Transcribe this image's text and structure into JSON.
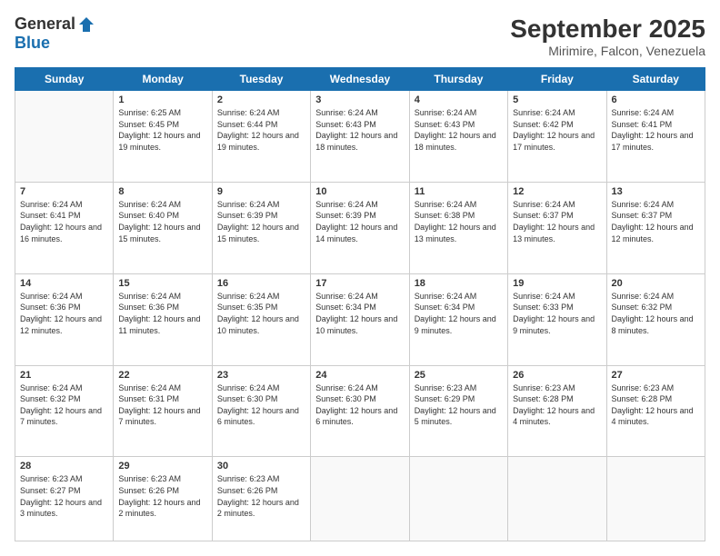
{
  "logo": {
    "general": "General",
    "blue": "Blue"
  },
  "title": "September 2025",
  "subtitle": "Mirimire, Falcon, Venezuela",
  "days": [
    "Sunday",
    "Monday",
    "Tuesday",
    "Wednesday",
    "Thursday",
    "Friday",
    "Saturday"
  ],
  "weeks": [
    [
      {
        "num": "",
        "sunrise": "",
        "sunset": "",
        "daylight": ""
      },
      {
        "num": "1",
        "sunrise": "Sunrise: 6:25 AM",
        "sunset": "Sunset: 6:45 PM",
        "daylight": "Daylight: 12 hours and 19 minutes."
      },
      {
        "num": "2",
        "sunrise": "Sunrise: 6:24 AM",
        "sunset": "Sunset: 6:44 PM",
        "daylight": "Daylight: 12 hours and 19 minutes."
      },
      {
        "num": "3",
        "sunrise": "Sunrise: 6:24 AM",
        "sunset": "Sunset: 6:43 PM",
        "daylight": "Daylight: 12 hours and 18 minutes."
      },
      {
        "num": "4",
        "sunrise": "Sunrise: 6:24 AM",
        "sunset": "Sunset: 6:43 PM",
        "daylight": "Daylight: 12 hours and 18 minutes."
      },
      {
        "num": "5",
        "sunrise": "Sunrise: 6:24 AM",
        "sunset": "Sunset: 6:42 PM",
        "daylight": "Daylight: 12 hours and 17 minutes."
      },
      {
        "num": "6",
        "sunrise": "Sunrise: 6:24 AM",
        "sunset": "Sunset: 6:41 PM",
        "daylight": "Daylight: 12 hours and 17 minutes."
      }
    ],
    [
      {
        "num": "7",
        "sunrise": "Sunrise: 6:24 AM",
        "sunset": "Sunset: 6:41 PM",
        "daylight": "Daylight: 12 hours and 16 minutes."
      },
      {
        "num": "8",
        "sunrise": "Sunrise: 6:24 AM",
        "sunset": "Sunset: 6:40 PM",
        "daylight": "Daylight: 12 hours and 15 minutes."
      },
      {
        "num": "9",
        "sunrise": "Sunrise: 6:24 AM",
        "sunset": "Sunset: 6:39 PM",
        "daylight": "Daylight: 12 hours and 15 minutes."
      },
      {
        "num": "10",
        "sunrise": "Sunrise: 6:24 AM",
        "sunset": "Sunset: 6:39 PM",
        "daylight": "Daylight: 12 hours and 14 minutes."
      },
      {
        "num": "11",
        "sunrise": "Sunrise: 6:24 AM",
        "sunset": "Sunset: 6:38 PM",
        "daylight": "Daylight: 12 hours and 13 minutes."
      },
      {
        "num": "12",
        "sunrise": "Sunrise: 6:24 AM",
        "sunset": "Sunset: 6:37 PM",
        "daylight": "Daylight: 12 hours and 13 minutes."
      },
      {
        "num": "13",
        "sunrise": "Sunrise: 6:24 AM",
        "sunset": "Sunset: 6:37 PM",
        "daylight": "Daylight: 12 hours and 12 minutes."
      }
    ],
    [
      {
        "num": "14",
        "sunrise": "Sunrise: 6:24 AM",
        "sunset": "Sunset: 6:36 PM",
        "daylight": "Daylight: 12 hours and 12 minutes."
      },
      {
        "num": "15",
        "sunrise": "Sunrise: 6:24 AM",
        "sunset": "Sunset: 6:36 PM",
        "daylight": "Daylight: 12 hours and 11 minutes."
      },
      {
        "num": "16",
        "sunrise": "Sunrise: 6:24 AM",
        "sunset": "Sunset: 6:35 PM",
        "daylight": "Daylight: 12 hours and 10 minutes."
      },
      {
        "num": "17",
        "sunrise": "Sunrise: 6:24 AM",
        "sunset": "Sunset: 6:34 PM",
        "daylight": "Daylight: 12 hours and 10 minutes."
      },
      {
        "num": "18",
        "sunrise": "Sunrise: 6:24 AM",
        "sunset": "Sunset: 6:34 PM",
        "daylight": "Daylight: 12 hours and 9 minutes."
      },
      {
        "num": "19",
        "sunrise": "Sunrise: 6:24 AM",
        "sunset": "Sunset: 6:33 PM",
        "daylight": "Daylight: 12 hours and 9 minutes."
      },
      {
        "num": "20",
        "sunrise": "Sunrise: 6:24 AM",
        "sunset": "Sunset: 6:32 PM",
        "daylight": "Daylight: 12 hours and 8 minutes."
      }
    ],
    [
      {
        "num": "21",
        "sunrise": "Sunrise: 6:24 AM",
        "sunset": "Sunset: 6:32 PM",
        "daylight": "Daylight: 12 hours and 7 minutes."
      },
      {
        "num": "22",
        "sunrise": "Sunrise: 6:24 AM",
        "sunset": "Sunset: 6:31 PM",
        "daylight": "Daylight: 12 hours and 7 minutes."
      },
      {
        "num": "23",
        "sunrise": "Sunrise: 6:24 AM",
        "sunset": "Sunset: 6:30 PM",
        "daylight": "Daylight: 12 hours and 6 minutes."
      },
      {
        "num": "24",
        "sunrise": "Sunrise: 6:24 AM",
        "sunset": "Sunset: 6:30 PM",
        "daylight": "Daylight: 12 hours and 6 minutes."
      },
      {
        "num": "25",
        "sunrise": "Sunrise: 6:23 AM",
        "sunset": "Sunset: 6:29 PM",
        "daylight": "Daylight: 12 hours and 5 minutes."
      },
      {
        "num": "26",
        "sunrise": "Sunrise: 6:23 AM",
        "sunset": "Sunset: 6:28 PM",
        "daylight": "Daylight: 12 hours and 4 minutes."
      },
      {
        "num": "27",
        "sunrise": "Sunrise: 6:23 AM",
        "sunset": "Sunset: 6:28 PM",
        "daylight": "Daylight: 12 hours and 4 minutes."
      }
    ],
    [
      {
        "num": "28",
        "sunrise": "Sunrise: 6:23 AM",
        "sunset": "Sunset: 6:27 PM",
        "daylight": "Daylight: 12 hours and 3 minutes."
      },
      {
        "num": "29",
        "sunrise": "Sunrise: 6:23 AM",
        "sunset": "Sunset: 6:26 PM",
        "daylight": "Daylight: 12 hours and 2 minutes."
      },
      {
        "num": "30",
        "sunrise": "Sunrise: 6:23 AM",
        "sunset": "Sunset: 6:26 PM",
        "daylight": "Daylight: 12 hours and 2 minutes."
      },
      {
        "num": "",
        "sunrise": "",
        "sunset": "",
        "daylight": ""
      },
      {
        "num": "",
        "sunrise": "",
        "sunset": "",
        "daylight": ""
      },
      {
        "num": "",
        "sunrise": "",
        "sunset": "",
        "daylight": ""
      },
      {
        "num": "",
        "sunrise": "",
        "sunset": "",
        "daylight": ""
      }
    ]
  ]
}
